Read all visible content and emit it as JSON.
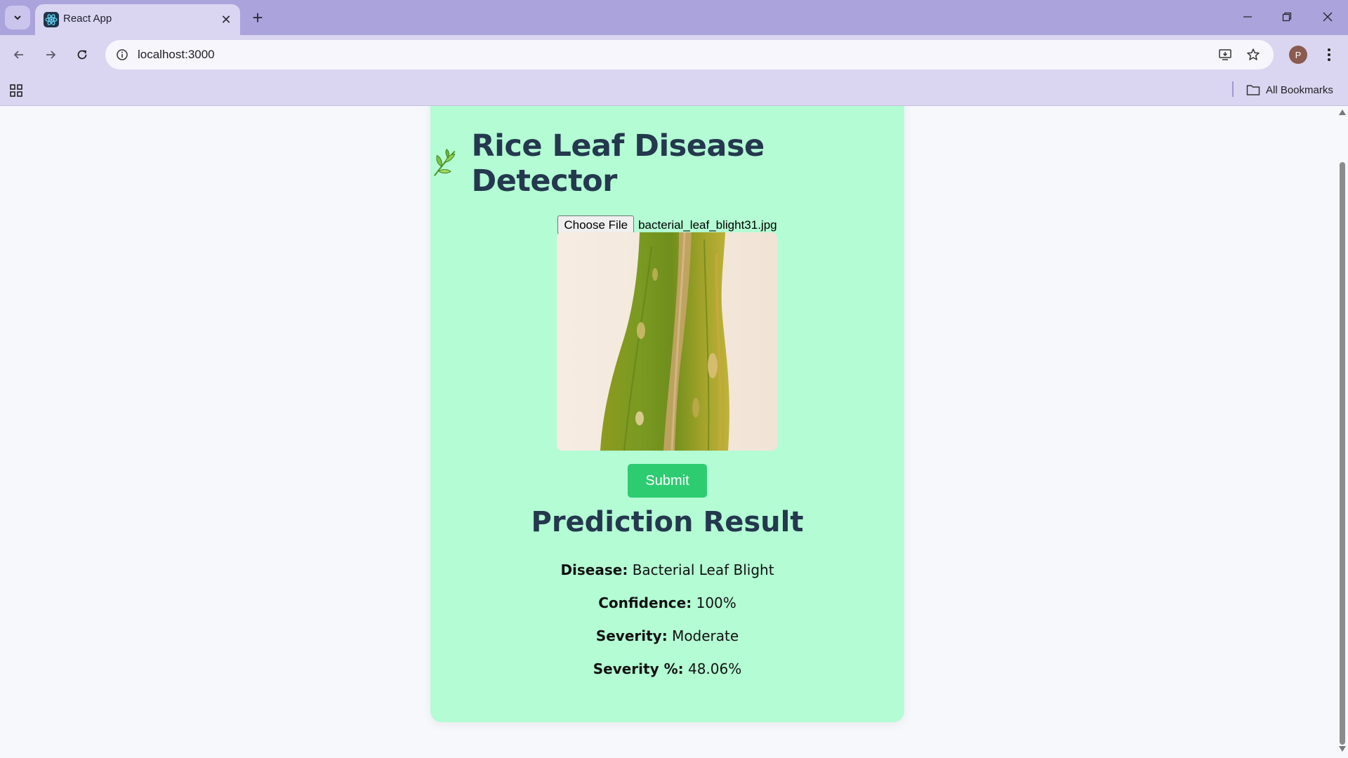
{
  "browser": {
    "tab_title": "React App",
    "url": "localhost:3000",
    "profile_initial": "P",
    "all_bookmarks_label": "All Bookmarks"
  },
  "app": {
    "title": "Rice Leaf Disease Detector",
    "choose_file_label": "Choose File",
    "file_name": "bacterial_leaf_blight31.jpg",
    "submit_label": "Submit",
    "result_title": "Prediction Result",
    "results": [
      {
        "label": "Disease:",
        "value": "Bacterial Leaf Blight"
      },
      {
        "label": "Confidence:",
        "value": "100%"
      },
      {
        "label": "Severity:",
        "value": "Moderate"
      },
      {
        "label": "Severity %:",
        "value": "48.06%"
      }
    ]
  },
  "colors": {
    "card_bg": "#b3fcd4",
    "title_color": "#24384e",
    "submit_bg": "#2ecc71",
    "chrome_bg": "#aba3dc"
  }
}
